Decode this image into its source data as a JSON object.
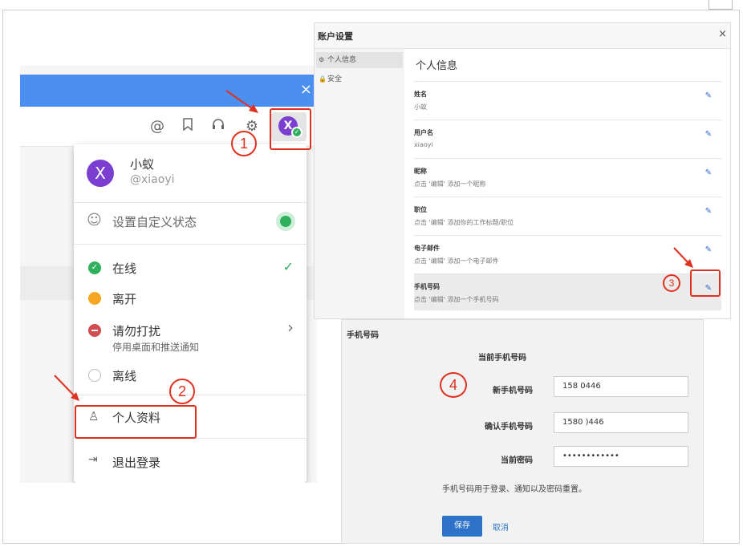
{
  "colors": {
    "accent_blue": "#4b8ff0",
    "avatar_purple": "#7a3fd1",
    "online_green": "#2fb05c",
    "away_orange": "#f5a623",
    "dnd_red": "#d24b4e",
    "annotation_red": "#e0301e",
    "save_blue": "#2b72c8"
  },
  "left_panel": {
    "close_icon": "×",
    "toolbar_icons": [
      "at-icon",
      "bookmark-icon",
      "headset-icon",
      "gear-icon"
    ],
    "avatar_letter": "X",
    "menu": {
      "user_name": "小蚁",
      "user_handle": "@xiaoyi",
      "custom_status": "设置自定义状态",
      "status_online": "在线",
      "status_away": "离开",
      "status_dnd": "请勿打扰",
      "status_dnd_sub": "停用桌面和推送通知",
      "status_offline": "离线",
      "profile": "个人资料",
      "logout": "退出登录",
      "checkmark": "✓",
      "chevron": "›"
    }
  },
  "account_settings": {
    "title": "账户设置",
    "close": "×",
    "sidebar": [
      {
        "label": "个人信息",
        "icon": "gear-icon"
      },
      {
        "label": "安全",
        "icon": "lock-icon"
      }
    ],
    "section_title": "个人信息",
    "fields": [
      {
        "label": "姓名",
        "value": "小蚁"
      },
      {
        "label": "用户名",
        "value": "xiaoyi"
      },
      {
        "label": "昵称",
        "value": "点击 '编辑' 添加一个昵称"
      },
      {
        "label": "职位",
        "value": "点击 '编辑' 添加你的工作标题/职位"
      },
      {
        "label": "电子邮件",
        "value": "点击 '编辑' 添加一个电子邮件"
      },
      {
        "label": "手机号码",
        "value": "点击 '编辑' 添加一个手机号码"
      }
    ]
  },
  "phone_form": {
    "title": "手机号码",
    "current_label": "当前手机号码",
    "new_label": "新手机号码",
    "new_value": "158 0446",
    "confirm_label": "确认手机号码",
    "confirm_value": "1580 )446",
    "password_label": "当前密码",
    "password_value": "••••••••••••",
    "note": "手机号码用于登录、通知以及密码重置。",
    "save": "保存",
    "cancel": "取消"
  },
  "annotations": [
    "1",
    "2",
    "3",
    "4"
  ]
}
